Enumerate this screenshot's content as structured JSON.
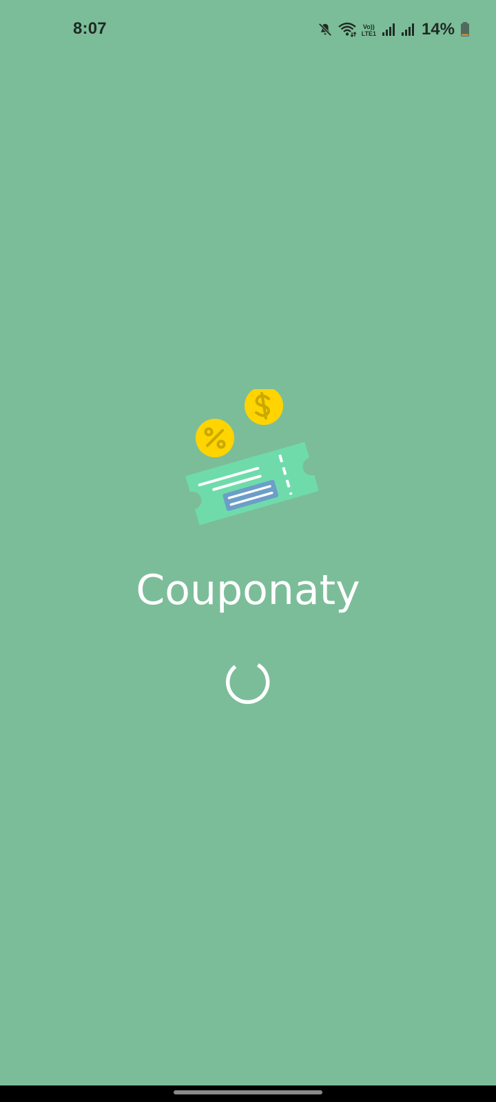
{
  "status_bar": {
    "time": "8:07",
    "network_label_top": "Vo))",
    "network_label_bottom": "LTE1",
    "battery_percent": "14%",
    "icons": [
      "mute-icon",
      "wifi-icon",
      "volte-icon",
      "signal-icon",
      "signal-icon",
      "battery-icon"
    ]
  },
  "splash": {
    "app_name": "Couponaty",
    "loading": true
  },
  "colors": {
    "background": "#7cbd99",
    "coupon": "#6fdbab",
    "coupon_panel": "#6b9ec8",
    "coin": "#ffd400",
    "coin_symbol": "#c9a800",
    "text": "#ffffff"
  }
}
